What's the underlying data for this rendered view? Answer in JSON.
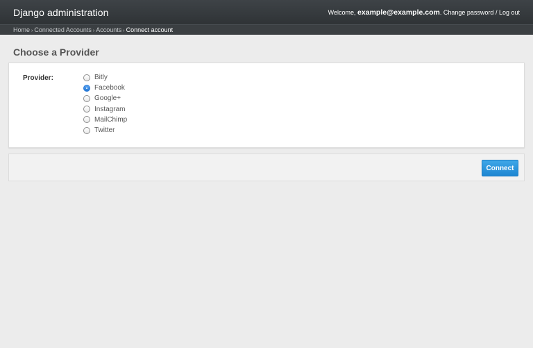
{
  "header": {
    "brand": "Django administration",
    "welcome": "Welcome,",
    "user_email": "example@example.com",
    "period": ".",
    "change_password": "Change password",
    "separator": "/",
    "logout": "Log out"
  },
  "breadcrumbs": {
    "items": [
      "Home",
      "Connected Accounts",
      "Accounts"
    ],
    "current": "Connect account",
    "sep": "›"
  },
  "page": {
    "title": "Choose a Provider"
  },
  "form": {
    "provider_label": "Provider:",
    "options": [
      "Bitly",
      "Facebook",
      "Google+",
      "Instagram",
      "MailChimp",
      "Twitter"
    ],
    "selected": "Facebook"
  },
  "submit": {
    "label": "Connect"
  }
}
